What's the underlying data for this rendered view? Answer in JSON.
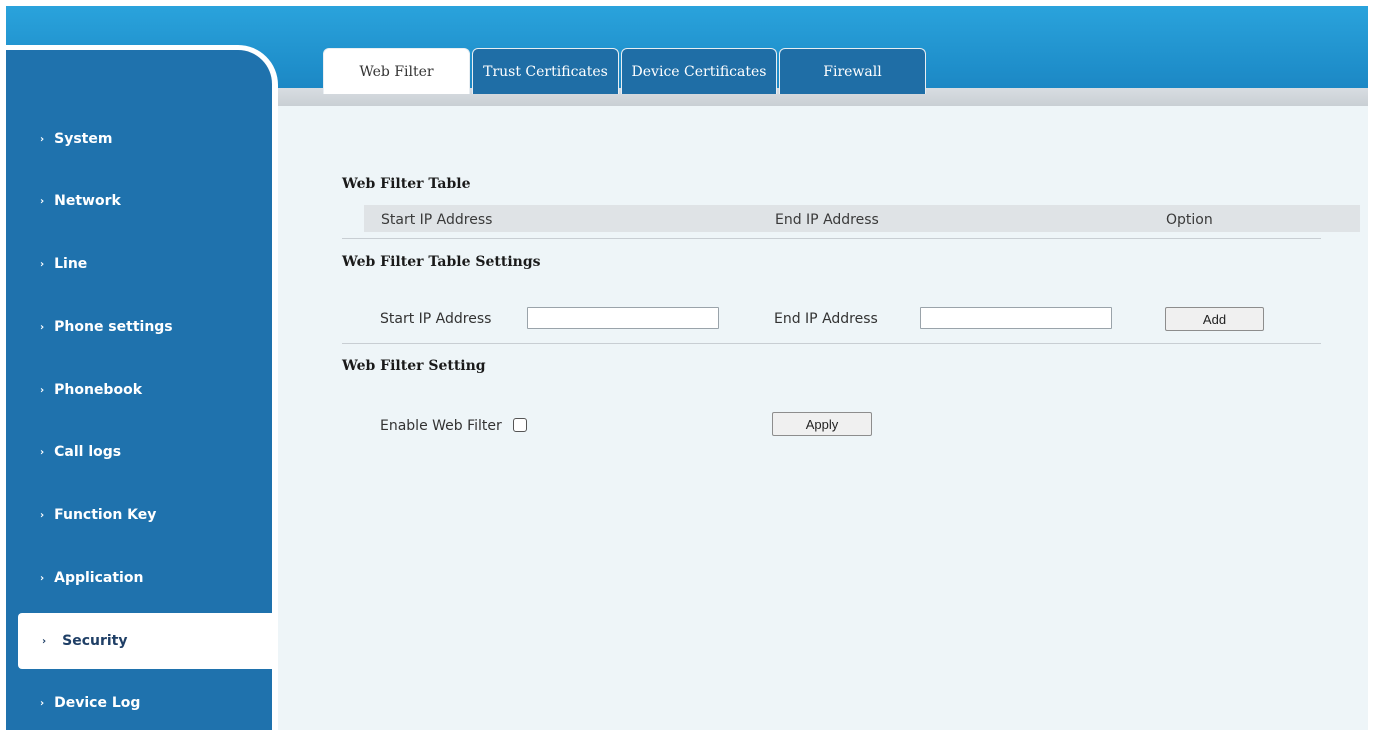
{
  "tabs": [
    {
      "label": "Web Filter",
      "active": true
    },
    {
      "label": "Trust Certificates",
      "active": false
    },
    {
      "label": "Device Certificates",
      "active": false
    },
    {
      "label": "Firewall",
      "active": false
    }
  ],
  "sidebar": {
    "chevron": "›",
    "items": [
      {
        "label": "System"
      },
      {
        "label": "Network"
      },
      {
        "label": "Line"
      },
      {
        "label": "Phone settings"
      },
      {
        "label": "Phonebook"
      },
      {
        "label": "Call logs"
      },
      {
        "label": "Function Key"
      },
      {
        "label": "Application"
      },
      {
        "label": "Security",
        "active": true
      },
      {
        "label": "Device Log"
      }
    ]
  },
  "web_filter_table": {
    "title": "Web Filter Table",
    "columns": [
      "Start IP Address",
      "End IP Address",
      "Option"
    ],
    "rows": []
  },
  "table_settings": {
    "title": "Web Filter Table Settings",
    "start_ip_label": "Start IP Address",
    "start_ip_value": "",
    "end_ip_label": "End IP Address",
    "end_ip_value": "",
    "add_label": "Add"
  },
  "filter_setting": {
    "title": "Web Filter Setting",
    "enable_label": "Enable Web Filter",
    "enabled": false,
    "apply_label": "Apply"
  },
  "colors": {
    "header_blue": "#1f8fcb",
    "sidebar_blue": "#1f72ad",
    "content_bg": "#eef5f8"
  }
}
